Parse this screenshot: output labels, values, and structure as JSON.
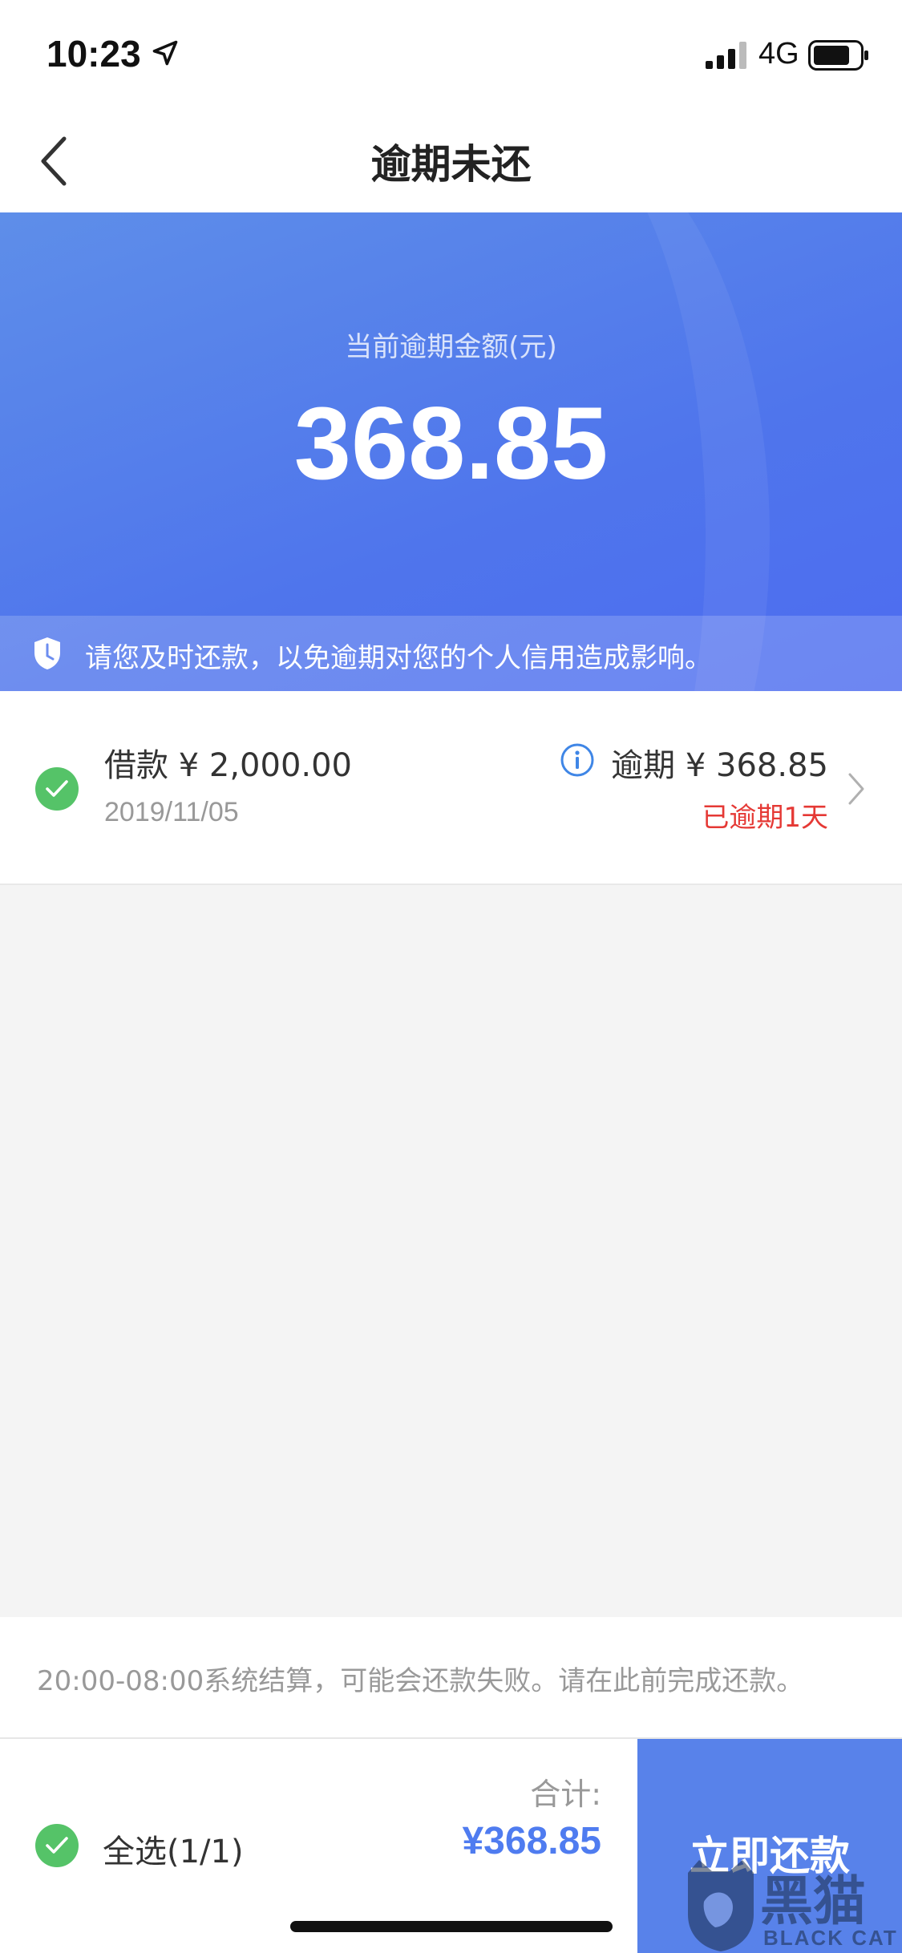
{
  "status_bar": {
    "time": "10:23",
    "network": "4G"
  },
  "nav": {
    "title": "逾期未还"
  },
  "hero": {
    "label": "当前逾期金额(元)",
    "amount": "368.85",
    "notice": "请您及时还款，以免逾期对您的个人信用造成影响。"
  },
  "loans": [
    {
      "title": "借款 ¥ 2,000.00",
      "date": "2019/11/05",
      "overdue_amount": "逾期 ¥ 368.85",
      "overdue_days": "已逾期1天"
    }
  ],
  "footer": {
    "note": "20:00-08:00系统结算，可能会还款失败。请在此前完成还款。"
  },
  "bottom_bar": {
    "select_all": "全选(1/1)",
    "total_label": "合计:",
    "total_amount": "¥368.85",
    "pay_button": "立即还款"
  },
  "watermark": {
    "cn": "黑猫",
    "en": "BLACK CAT"
  },
  "colors": {
    "accent": "#5882ea",
    "success": "#55c368",
    "danger": "#e53935"
  }
}
